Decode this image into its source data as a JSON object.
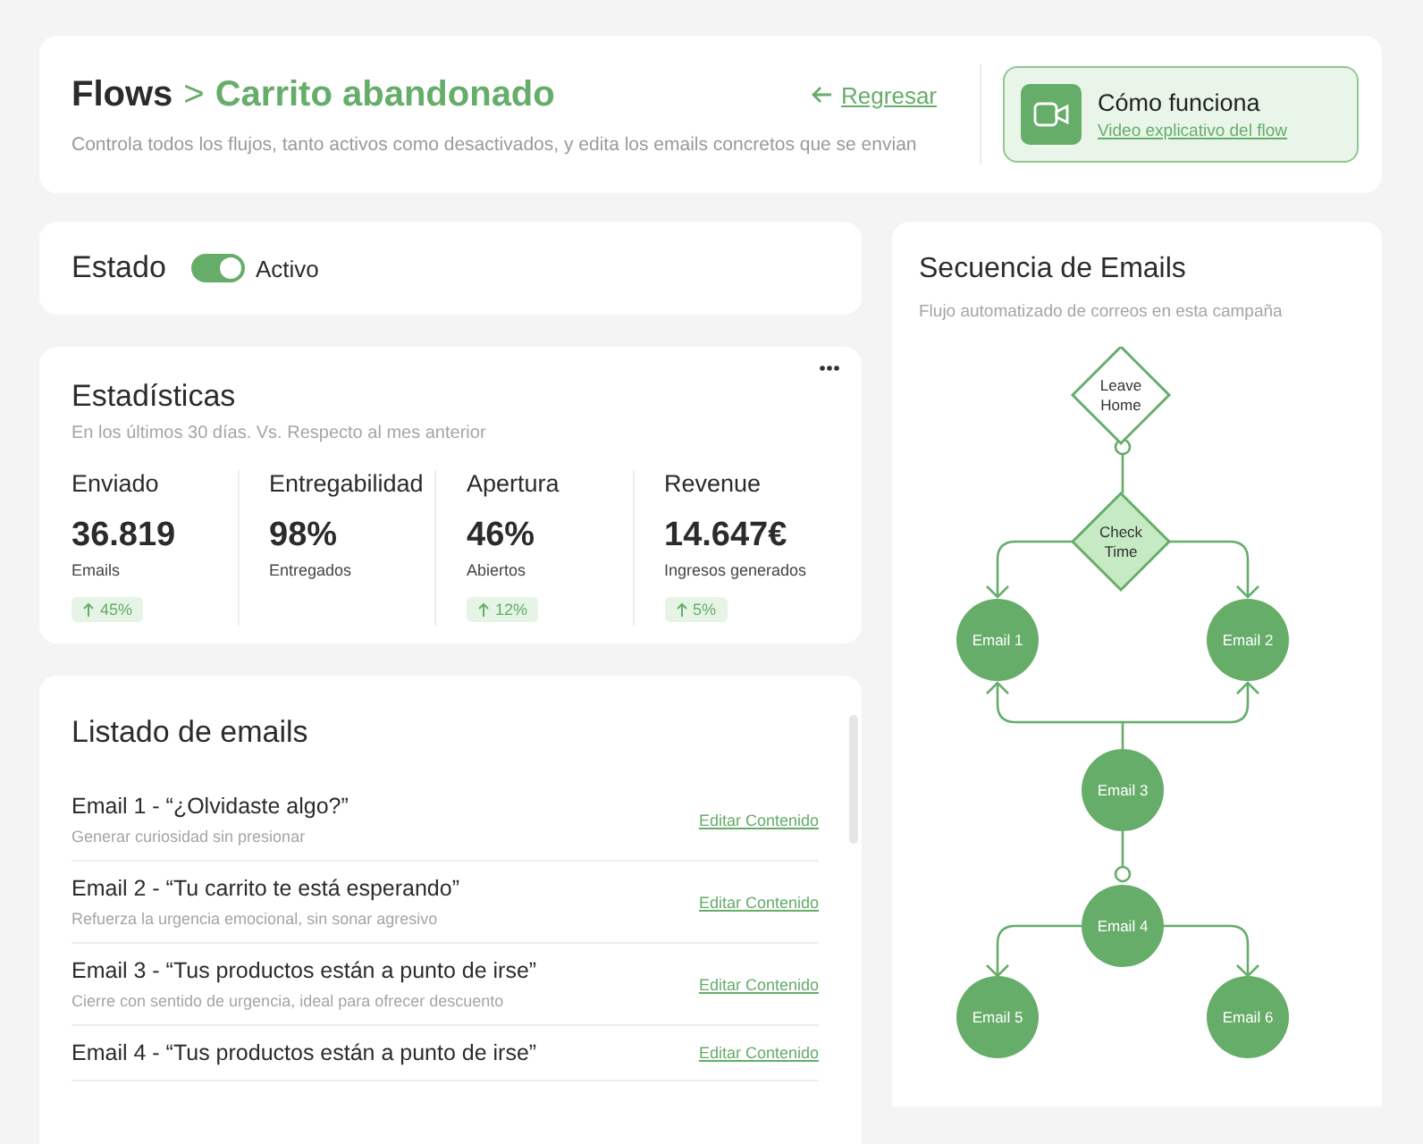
{
  "header": {
    "breadcrumb_root": "Flows",
    "separator": ">",
    "title": "Carrito abandonado",
    "subtitle": "Controla todos los flujos, tanto activos como desactivados, y edita los emails concretos que se envian",
    "back_link": "Regresar",
    "help": {
      "title": "Cómo funciona",
      "link": "Video explicativo del flow"
    }
  },
  "estado": {
    "label": "Estado",
    "on": true,
    "state_text": "Activo"
  },
  "stats": {
    "title": "Estadísticas",
    "subtitle": "En los últimos 30 días. Vs. Respecto al mes anterior",
    "items": [
      {
        "label": "Enviado",
        "value": "36.819",
        "caption": "Emails",
        "change": "45%"
      },
      {
        "label": "Entregabilidad",
        "value": "98%",
        "caption": "Entregados"
      },
      {
        "label": "Apertura",
        "value": "46%",
        "caption": "Abiertos",
        "change": "12%"
      },
      {
        "label": "Revenue",
        "value": "14.647€",
        "caption": "Ingresos generados",
        "change": "5%"
      }
    ]
  },
  "emails": {
    "title": "Listado de emails",
    "items": [
      {
        "title": "Email 1 - “¿Olvidaste algo?”",
        "subtitle": "Generar curiosidad sin presionar",
        "action": "Editar Contenido"
      },
      {
        "title": "Email 2 - “Tu carrito te está esperando”",
        "subtitle": "Refuerza la urgencia emocional, sin sonar agresivo",
        "action": "Editar Contenido"
      },
      {
        "title": "Email 3 - “Tus productos están a punto de irse”",
        "subtitle": "Cierre con sentido de urgencia, ideal para ofrecer descuento",
        "action": "Editar Contenido"
      },
      {
        "title": "Email 4 - “Tus productos están a punto de irse”",
        "action": "Editar Contenido"
      }
    ]
  },
  "flow": {
    "title": "Secuencia de Emails",
    "subtitle": "Flujo automatizado de correos en esta campaña",
    "nodes": [
      {
        "kind": "start",
        "label": [
          "Leave",
          "Home"
        ]
      },
      {
        "kind": "check",
        "label": [
          "Check",
          "Time"
        ]
      },
      {
        "kind": "email",
        "label": [
          "Email 1"
        ]
      },
      {
        "kind": "email",
        "label": [
          "Email 2"
        ]
      },
      {
        "kind": "email",
        "label": [
          "Email 3"
        ]
      },
      {
        "kind": "email",
        "label": [
          "Email 4"
        ]
      },
      {
        "kind": "email",
        "label": [
          "Email 5"
        ]
      },
      {
        "kind": "email",
        "label": [
          "Email 6"
        ]
      }
    ]
  }
}
